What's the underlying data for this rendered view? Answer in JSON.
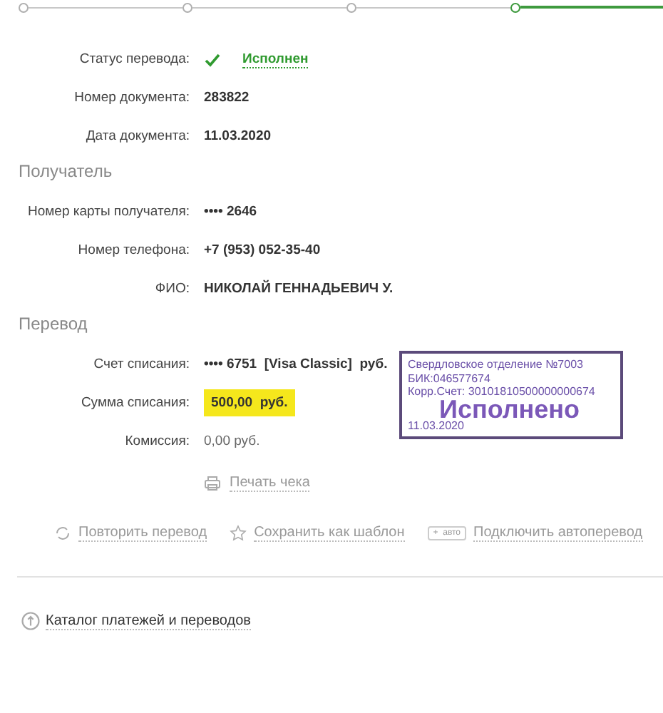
{
  "progress_steps": [
    {
      "selected": false
    },
    {
      "selected": false
    },
    {
      "selected": false
    },
    {
      "selected": true
    }
  ],
  "details": [
    {
      "label": "Статус перевода:",
      "value": "Исполнен",
      "kind": "status"
    },
    {
      "label": "Номер документа:",
      "value": "283822",
      "kind": "plain"
    },
    {
      "label": "Дата документа:",
      "value": "11.03.2020",
      "kind": "plain"
    }
  ],
  "sections": [
    {
      "title": "Получатель",
      "rows": [
        {
          "label": "Номер карты получателя:",
          "value": "•••• 2646",
          "kind": "plain"
        },
        {
          "label": "Номер телефона:",
          "value": "+7 (953) 052-35-40",
          "kind": "plain"
        },
        {
          "label": "ФИО:",
          "value": "НИКОЛАЙ ГЕННАДЬЕВИЧ У.",
          "kind": "plain"
        }
      ]
    },
    {
      "title": "Перевод",
      "rows": [
        {
          "label": "Счет списания:",
          "value": "•••• 6751  [Visa Classic]  руб.",
          "kind": "plain"
        },
        {
          "label": "Сумма списания:",
          "value": "500,00  руб.",
          "kind": "highlight"
        },
        {
          "label": "Комиссия:",
          "value": "0,00 руб.",
          "kind": "light"
        }
      ]
    }
  ],
  "stamp": {
    "lines": [
      "Свердловское отделение №7003",
      "БИК:046577674",
      "Корр.Счет: 30101810500000000674"
    ],
    "status": "Исполнено",
    "date": "11.03.2020"
  },
  "print_link": "Печать чека",
  "actions": [
    {
      "kind": "repeat",
      "label": "Повторить перевод"
    },
    {
      "kind": "template",
      "label": "Сохранить как шаблон"
    },
    {
      "kind": "auto",
      "badge": "+  авто",
      "label": "Подключить автоперевод"
    }
  ],
  "catalog_link": "Каталог платежей и переводов"
}
